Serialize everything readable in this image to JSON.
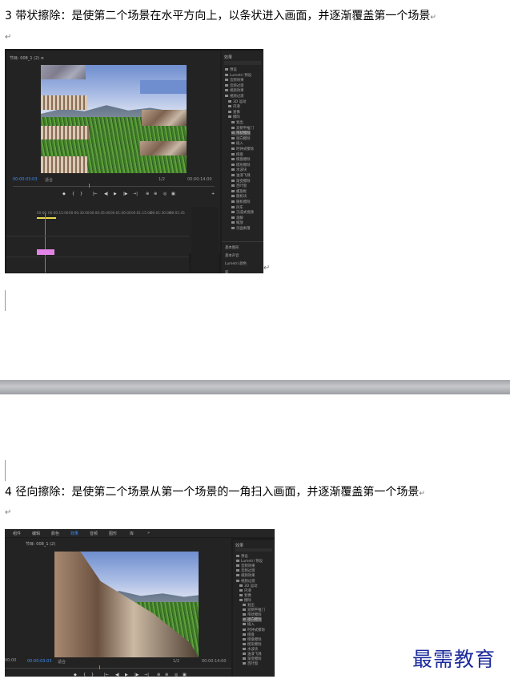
{
  "section3": {
    "text": "3 带状擦除：是使第二个场景在水平方向上，以条状进入画面，并逐渐覆盖第一个场景",
    "return_mark": "↵",
    "after_mark": "↵",
    "screenshot": {
      "sequence_tab": "节目: 008_1 (2)",
      "tab_close": "≡",
      "timecode_left": "00:00:03:03",
      "fit_label": "适合",
      "quality": "1/2",
      "timecode_right": "00:00:14:00",
      "panel_title": "效果",
      "effects": [
        "预设",
        "Lumetri 预设",
        "音频效果",
        "音频过渡",
        "视频效果",
        "视频过渡",
        "3D 运动",
        "内滑",
        "划像",
        "擦除",
        "划出",
        "双侧平推门",
        "带状擦除",
        "径向擦除",
        "插入",
        "时钟式擦除",
        "棋盘",
        "棋盘擦除",
        "楔形擦除",
        "水波块",
        "油漆飞溅",
        "渐变擦除",
        "百叶窗",
        "螺旋框",
        "随机块",
        "随机擦除",
        "风车",
        "沉浸式视频",
        "溶解",
        "缩放",
        "页面剥落"
      ],
      "selected_effect": "带状擦除",
      "bottom_panels": [
        "基本图形",
        "基本声音",
        "Lumetri 颜色",
        "库"
      ],
      "ruler_ticks": [
        "00:00",
        "00:00:15:00",
        "00:00:30:00",
        "00:00:45:00",
        "00:01:00:00",
        "00:01:15:00",
        "00:01:30:00",
        "00:01:45"
      ],
      "transport": [
        "◆",
        "{",
        "}",
        "|←",
        "◀|",
        "▶",
        "|▶",
        "→|",
        "⊕",
        "⊕",
        "◎",
        "▣",
        "+"
      ]
    }
  },
  "section4": {
    "text": "4 径向擦除：是使第二个场景从第一个场景的一角扫入画面，并逐渐覆盖第一个场景",
    "return_mark": "↵",
    "after_mark": "↵",
    "screenshot": {
      "workspace_tabs": [
        "组件",
        "编辑",
        "颜色",
        "效果",
        "音频",
        "图形",
        "库",
        "»"
      ],
      "active_workspace": "效果",
      "sequence_tab": "节目: 008_1 (2)",
      "timecode_left": "00:00:03:03",
      "fit_label": "适合",
      "quality": "1/2",
      "timecode_right": "00:00:14:00",
      "panel_title": "效果",
      "effects": [
        "预设",
        "Lumetri 预设",
        "音频效果",
        "音频过渡",
        "视频效果",
        "视频过渡",
        "3D 运动",
        "内滑",
        "划像",
        "擦除",
        "划出",
        "双侧平推门",
        "带状擦除",
        "径向擦除",
        "插入",
        "时钟式擦除",
        "棋盘",
        "棋盘擦除",
        "楔形擦除",
        "水波块",
        "油漆飞溅",
        "渐变擦除",
        "百叶窗"
      ],
      "selected_effect": "径向擦除",
      "left_timecode_edge": "00:00"
    }
  },
  "watermark": "最需教育"
}
